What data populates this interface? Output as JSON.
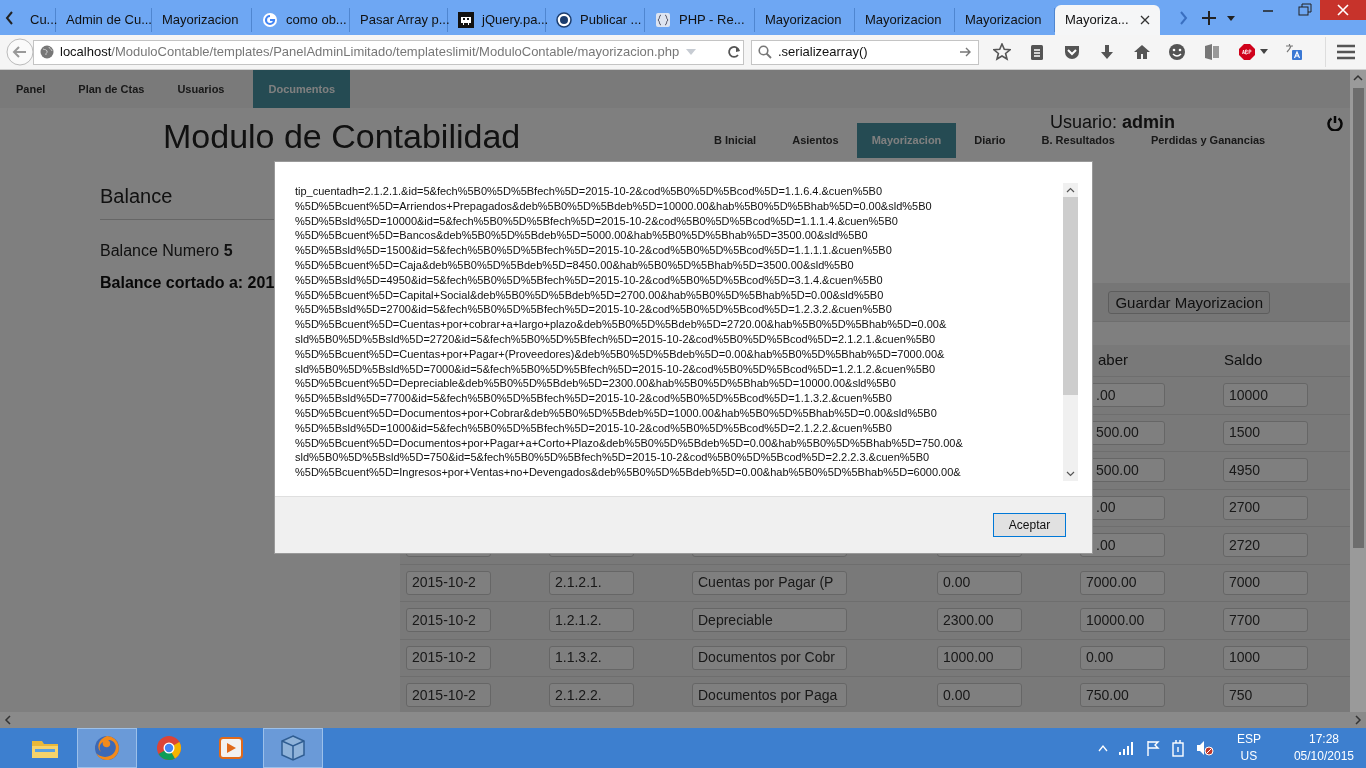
{
  "browser": {
    "tabs": [
      {
        "label": "Cu...",
        "kind": "plain",
        "selected": false
      },
      {
        "label": "Admin de Cu...",
        "kind": "plain",
        "selected": false
      },
      {
        "label": "Mayorizacion",
        "kind": "plain",
        "selected": false
      },
      {
        "label": "como ob...",
        "kind": "google",
        "selected": false
      },
      {
        "label": "Pasar Array p...",
        "kind": "plain",
        "selected": false
      },
      {
        "label": "jQuery.pa...",
        "kind": "invader",
        "selected": false
      },
      {
        "label": "Publicar ...",
        "kind": "cl",
        "selected": false
      },
      {
        "label": "PHP - Re...",
        "kind": "braces",
        "selected": false
      },
      {
        "label": "Mayorizacion",
        "kind": "plain",
        "selected": false
      },
      {
        "label": "Mayorizacion",
        "kind": "plain",
        "selected": false
      },
      {
        "label": "Mayorizacion",
        "kind": "plain",
        "selected": false
      },
      {
        "label": "Mayoriza...",
        "kind": "plain",
        "selected": true
      }
    ],
    "url": {
      "host": "localhost",
      "path": "/ModuloContable/templates/PanelAdminLimitado/templateslimit/ModuloContable/mayorizacion.php"
    },
    "search": ".serializearray()"
  },
  "page": {
    "menu": [
      {
        "label": "Panel",
        "selected": false
      },
      {
        "label": "Plan de Ctas",
        "selected": false
      },
      {
        "label": "Usuarios",
        "selected": false
      },
      {
        "label": "Documentos",
        "selected": true
      }
    ],
    "title": "Modulo de Contabilidad",
    "user": "Usuario: **admin**",
    "subtabs": [
      {
        "label": "B Inicial",
        "selected": false
      },
      {
        "label": "Asientos",
        "selected": false
      },
      {
        "label": "Mayorizacion",
        "selected": true
      },
      {
        "label": "Diario",
        "selected": false
      },
      {
        "label": "B. Resultados",
        "selected": false
      },
      {
        "label": "Perdidas y Ganancias",
        "selected": false
      }
    ],
    "balance": {
      "heading": "Balance",
      "number": "Balance Numero **5**",
      "cut_date": "Balance cortado a: 201"
    },
    "save_button": "Guardar Mayorizacion",
    "table": {
      "header": {
        "column_5": "aber",
        "column_6": "Saldo"
      },
      "rows": [
        {
          "column_5": ".00",
          "column_6": "10000"
        },
        {
          "column_5": "500.00",
          "column_6": "1500"
        },
        {
          "column_5": "500.00",
          "column_6": "4950"
        },
        {
          "column_5": ".00",
          "column_6": "2700"
        },
        {
          "column_5": ".00",
          "column_6": "2720"
        },
        {
          "column_1": "2015-10-2",
          "column_2": "2.1.2.1.",
          "column_3": "Cuentas por Pagar (P",
          "column_4": "0.00",
          "column_5": "7000.00",
          "column_6": "7000"
        },
        {
          "column_1": "2015-10-2",
          "column_2": "1.2.1.2.",
          "column_3": "Depreciable",
          "column_4": "2300.00",
          "column_5": "10000.00",
          "column_6": "7700"
        },
        {
          "column_1": "2015-10-2",
          "column_2": "1.1.3.2.",
          "column_3": "Documentos por Cobr",
          "column_4": "1000.00",
          "column_5": "0.00",
          "column_6": "1000"
        },
        {
          "column_1": "2015-10-2",
          "column_2": "2.1.2.2.",
          "column_3": "Documentos por Paga",
          "column_4": "0.00",
          "column_5": "750.00",
          "column_6": "750"
        }
      ]
    }
  },
  "modal": {
    "text_lines": [
      "tip_cuentadh=2.1.2.1.&id=5&fech%5B0%5D%5Bfech%5D=2015-10-2&cod%5B0%5D%5Bcod%5D=1.1.6.4.&cuen%5B0",
      "%5D%5Bcuent%5D=Arriendos+Prepagados&deb%5B0%5D%5Bdeb%5D=10000.00&hab%5B0%5D%5Bhab%5D=0.00&sld%5B0",
      "%5D%5Bsld%5D=10000&id=5&fech%5B0%5D%5Bfech%5D=2015-10-2&cod%5B0%5D%5Bcod%5D=1.1.1.4.&cuen%5B0",
      "%5D%5Bcuent%5D=Bancos&deb%5B0%5D%5Bdeb%5D=5000.00&hab%5B0%5D%5Bhab%5D=3500.00&sld%5B0",
      "%5D%5Bsld%5D=1500&id=5&fech%5B0%5D%5Bfech%5D=2015-10-2&cod%5B0%5D%5Bcod%5D=1.1.1.1.&cuen%5B0",
      "%5D%5Bcuent%5D=Caja&deb%5B0%5D%5Bdeb%5D=8450.00&hab%5B0%5D%5Bhab%5D=3500.00&sld%5B0",
      "%5D%5Bsld%5D=4950&id=5&fech%5B0%5D%5Bfech%5D=2015-10-2&cod%5B0%5D%5Bcod%5D=3.1.4.&cuen%5B0",
      "%5D%5Bcuent%5D=Capital+Social&deb%5B0%5D%5Bdeb%5D=2700.00&hab%5B0%5D%5Bhab%5D=0.00&sld%5B0",
      "%5D%5Bsld%5D=2700&id=5&fech%5B0%5D%5Bfech%5D=2015-10-2&cod%5B0%5D%5Bcod%5D=1.2.3.2.&cuen%5B0",
      "%5D%5Bcuent%5D=Cuentas+por+cobrar+a+largo+plazo&deb%5B0%5D%5Bdeb%5D=2720.00&hab%5B0%5D%5Bhab%5D=0.00&",
      "sld%5B0%5D%5Bsld%5D=2720&id=5&fech%5B0%5D%5Bfech%5D=2015-10-2&cod%5B0%5D%5Bcod%5D=2.1.2.1.&cuen%5B0",
      "%5D%5Bcuent%5D=Cuentas+por+Pagar+(Proveedores)&deb%5B0%5D%5Bdeb%5D=0.00&hab%5B0%5D%5Bhab%5D=7000.00&",
      "sld%5B0%5D%5Bsld%5D=7000&id=5&fech%5B0%5D%5Bfech%5D=2015-10-2&cod%5B0%5D%5Bcod%5D=1.2.1.2.&cuen%5B0",
      "%5D%5Bcuent%5D=Depreciable&deb%5B0%5D%5Bdeb%5D=2300.00&hab%5B0%5D%5Bhab%5D=10000.00&sld%5B0",
      "%5D%5Bsld%5D=7700&id=5&fech%5B0%5D%5Bfech%5D=2015-10-2&cod%5B0%5D%5Bcod%5D=1.1.3.2.&cuen%5B0",
      "%5D%5Bcuent%5D=Documentos+por+Cobrar&deb%5B0%5D%5Bdeb%5D=1000.00&hab%5B0%5D%5Bhab%5D=0.00&sld%5B0",
      "%5D%5Bsld%5D=1000&id=5&fech%5B0%5D%5Bfech%5D=2015-10-2&cod%5B0%5D%5Bcod%5D=2.1.2.2.&cuen%5B0",
      "%5D%5Bcuent%5D=Documentos+por+Pagar+a+Corto+Plazo&deb%5B0%5D%5Bdeb%5D=0.00&hab%5B0%5D%5Bhab%5D=750.00&",
      "sld%5B0%5D%5Bsld%5D=750&id=5&fech%5B0%5D%5Bfech%5D=2015-10-2&cod%5B0%5D%5Bcod%5D=2.2.2.3.&cuen%5B0",
      "%5D%5Bcuent%5D=Ingresos+por+Ventas+no+Devengados&deb%5B0%5D%5Bdeb%5D=0.00&hab%5B0%5D%5Bhab%5D=6000.00&"
    ],
    "button": "Aceptar"
  },
  "taskbar": {
    "apps": [
      {
        "kind": "folder",
        "selected": false
      },
      {
        "kind": "firefox",
        "selected": true
      },
      {
        "kind": "chrome",
        "selected": false
      },
      {
        "kind": "media",
        "selected": false
      },
      {
        "kind": "cube",
        "selected": true
      }
    ],
    "language": "ESP",
    "layout": "US",
    "time": "17:28",
    "date": "05/10/2015"
  }
}
